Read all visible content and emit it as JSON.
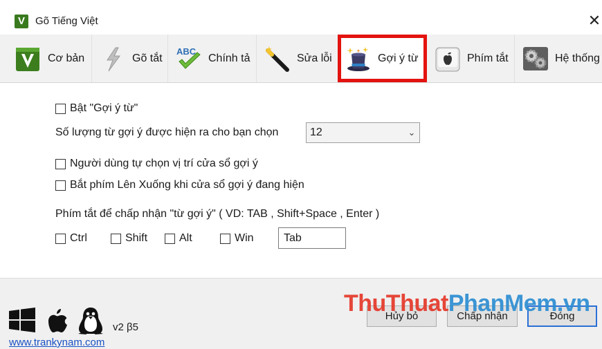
{
  "window": {
    "title": "Gõ Tiếng Việt",
    "app_icon_letter": "V",
    "close_glyph": "✕"
  },
  "tabs": [
    {
      "label": "Cơ bản",
      "icon": "v-logo-icon"
    },
    {
      "label": "Gõ tắt",
      "icon": "lightning-icon"
    },
    {
      "label": "Chính tả",
      "icon": "abc-check-icon"
    },
    {
      "label": "Sửa lỗi",
      "icon": "magic-wand-icon"
    },
    {
      "label": "Gợi ý từ",
      "icon": "magic-hat-icon",
      "selected": true
    },
    {
      "label": "Phím tắt",
      "icon": "apple-key-icon"
    },
    {
      "label": "Hệ thống",
      "icon": "gears-icon"
    }
  ],
  "settings": {
    "enable_suggest": {
      "label": "Bật \"Gợi ý từ\"",
      "checked": false
    },
    "count": {
      "label": "Số lượng từ gợi ý được hiện ra cho bạn chọn",
      "value": "12"
    },
    "user_position": {
      "label": "Người dùng tự chọn vị trí cửa sổ gợi ý",
      "checked": false
    },
    "arrow_keys": {
      "label": "Bắt phím Lên Xuống khi cửa sổ gợi ý đang hiện",
      "checked": false
    },
    "shortcut_heading": "Phím tắt để chấp nhận \"từ gợi ý\" ( VD: TAB , Shift+Space , Enter )",
    "modifiers": [
      {
        "label": "Ctrl",
        "checked": false
      },
      {
        "label": "Shift",
        "checked": false
      },
      {
        "label": "Alt",
        "checked": false
      },
      {
        "label": "Win",
        "checked": false
      }
    ],
    "key_value": "Tab"
  },
  "footer": {
    "version": "v2 β5",
    "website": "www.trankynam.com",
    "cancel_label": "Hủy bỏ",
    "accept_label": "Chấp nhận",
    "close_label": "Đóng",
    "watermark_a": "ThuThuat",
    "watermark_b": "PhanMem.vn",
    "os_icons": [
      "windows-logo-icon",
      "apple-logo-icon",
      "linux-penguin-icon"
    ]
  },
  "colors": {
    "highlight": "#e3130f",
    "accent": "#2a6fd6",
    "link": "#1a52c4"
  }
}
